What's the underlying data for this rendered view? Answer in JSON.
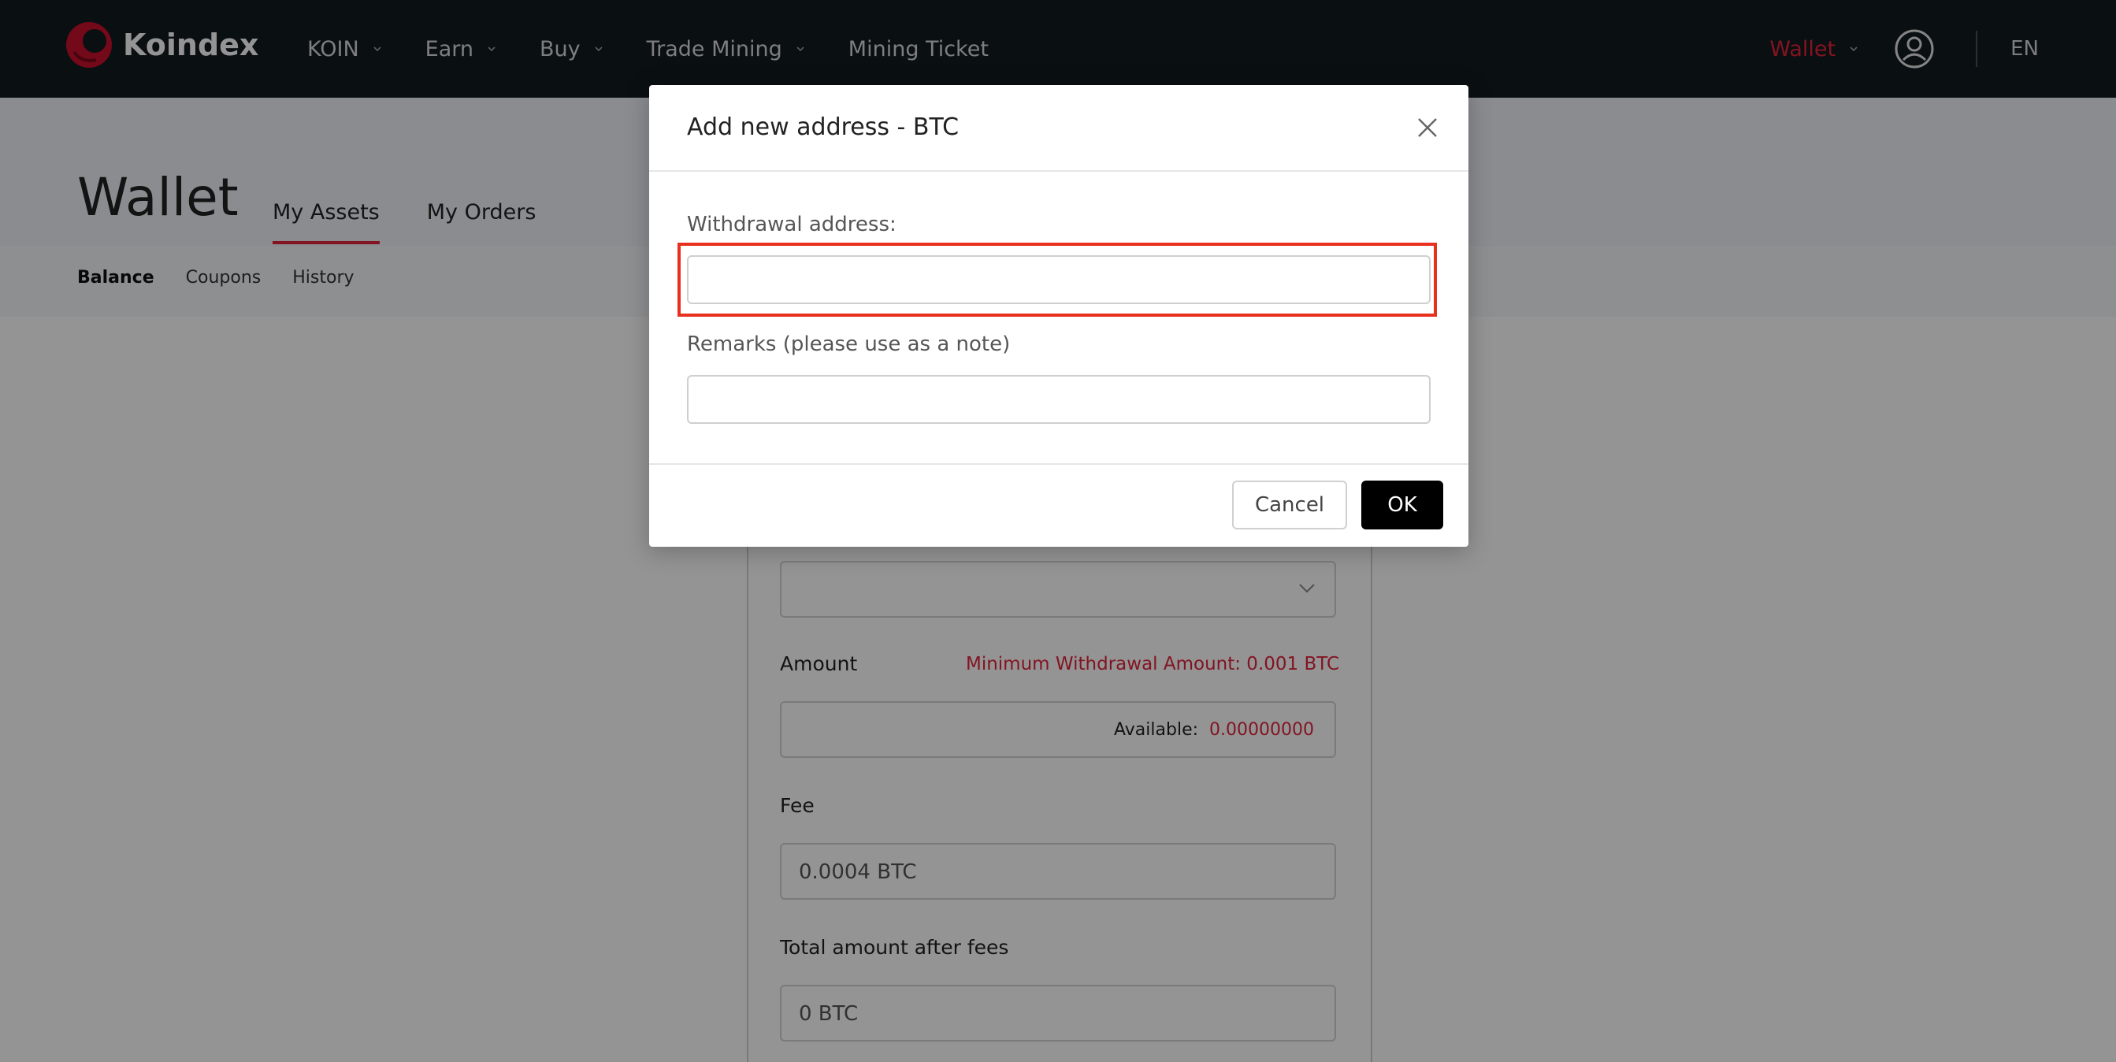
{
  "header": {
    "brand": "Koindex",
    "nav": [
      {
        "label": "KOIN",
        "has_dropdown": true
      },
      {
        "label": "Earn",
        "has_dropdown": true
      },
      {
        "label": "Buy",
        "has_dropdown": true
      },
      {
        "label": "Trade Mining",
        "has_dropdown": true
      },
      {
        "label": "Mining Ticket",
        "has_dropdown": false
      }
    ],
    "wallet_label": "Wallet",
    "language": "EN"
  },
  "page": {
    "title": "Wallet",
    "tabs": [
      {
        "label": "My Assets"
      },
      {
        "label": "My Orders"
      }
    ],
    "subnav": [
      {
        "label": "Balance"
      },
      {
        "label": "Coupons"
      },
      {
        "label": "History"
      }
    ]
  },
  "withdraw_form": {
    "amount_label": "Amount",
    "min_note": "Minimum Withdrawal Amount: 0.001 BTC",
    "available_label": "Available:",
    "available_value": "0.00000000",
    "fee_label": "Fee",
    "fee_value": "0.0004 BTC",
    "total_label": "Total amount after fees",
    "total_value": "0 BTC"
  },
  "modal": {
    "title": "Add new address - BTC",
    "address_label": "Withdrawal address:",
    "address_value": "",
    "remarks_label": "Remarks (please use as a note)",
    "remarks_value": "",
    "cancel_label": "Cancel",
    "ok_label": "OK"
  },
  "colors": {
    "accent": "#e0243c",
    "header_bg": "#121a1f",
    "highlight": "#e8301e"
  },
  "icons": {
    "logo": "koindex-logo-icon",
    "user": "user-circle-icon",
    "close": "close-icon",
    "dropdown": "chevron-down-icon"
  }
}
